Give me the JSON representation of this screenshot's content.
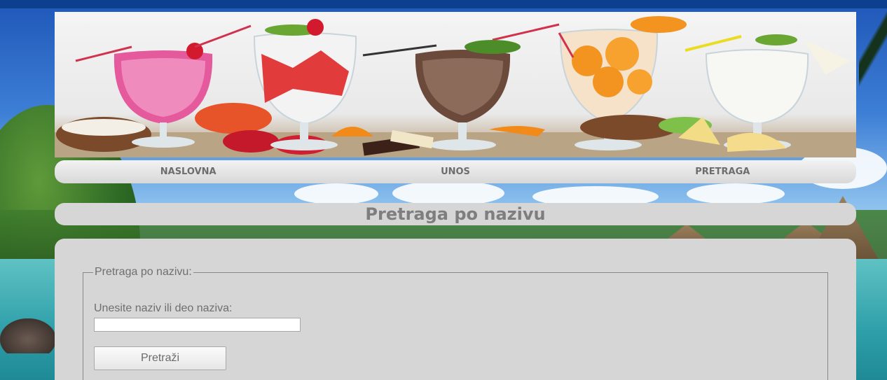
{
  "nav": {
    "items": [
      {
        "label": "NASLOVNA"
      },
      {
        "label": "UNOS"
      },
      {
        "label": "PRETRAGA"
      }
    ]
  },
  "page": {
    "title": "Pretraga po nazivu"
  },
  "search_form": {
    "legend": "Pretraga po nazivu:",
    "field_label": "Unesite naziv ili deo naziva:",
    "input_value": "",
    "button_label": "Pretraži"
  },
  "colors": {
    "panel_bg": "#d6d6d6",
    "text_gray": "#6f6f6f",
    "nav_text": "#6d6d6d"
  }
}
